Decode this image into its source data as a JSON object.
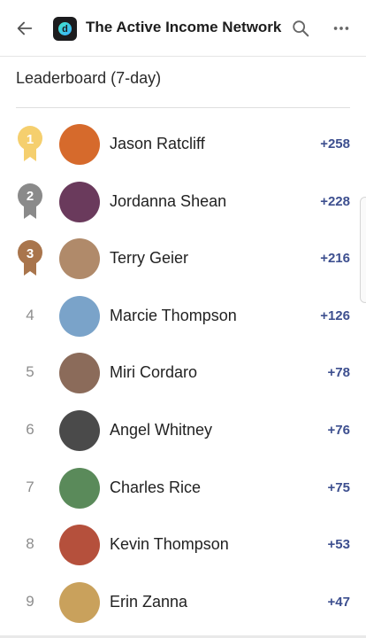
{
  "header": {
    "back_icon": "arrow-left-icon",
    "logo_letter": "d",
    "title": "The Active Income Network",
    "search_icon": "search-icon",
    "more_icon": "more-horizontal-icon"
  },
  "section": {
    "title": "Leaderboard (7-day)"
  },
  "colors": {
    "gold": "#f5cf6e",
    "silver": "#8a8a8a",
    "bronze": "#a9754c",
    "points": "#3d4f8f"
  },
  "leaderboard": [
    {
      "rank": "1",
      "name": "Jason Ratcliff",
      "points": "+258",
      "avatar_color": "#d66a2c"
    },
    {
      "rank": "2",
      "name": "Jordanna Shean",
      "points": "+228",
      "avatar_color": "#6a3a5c"
    },
    {
      "rank": "3",
      "name": "Terry Geier",
      "points": "+216",
      "avatar_color": "#b08a6a"
    },
    {
      "rank": "4",
      "name": "Marcie Thompson",
      "points": "+126",
      "avatar_color": "#7aa3c9"
    },
    {
      "rank": "5",
      "name": "Miri Cordaro",
      "points": "+78",
      "avatar_color": "#8b6b5a"
    },
    {
      "rank": "6",
      "name": "Angel Whitney",
      "points": "+76",
      "avatar_color": "#4a4a4a"
    },
    {
      "rank": "7",
      "name": "Charles Rice",
      "points": "+75",
      "avatar_color": "#5a8a5a"
    },
    {
      "rank": "8",
      "name": "Kevin Thompson",
      "points": "+53",
      "avatar_color": "#b5503c"
    },
    {
      "rank": "9",
      "name": "Erin Zanna",
      "points": "+47",
      "avatar_color": "#c9a15c"
    }
  ]
}
